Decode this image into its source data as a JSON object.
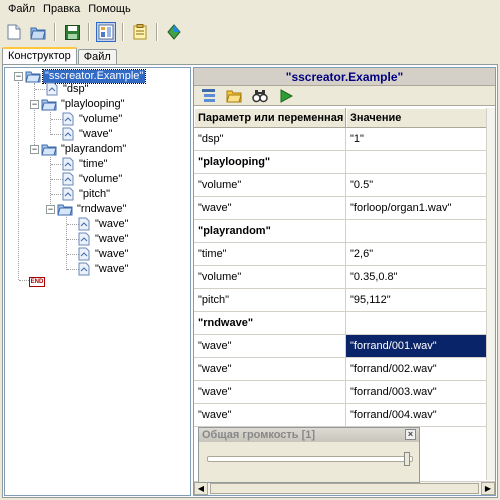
{
  "menu": {
    "file": "Файл",
    "edit": "Правка",
    "help": "Помощь"
  },
  "toolbar": {
    "icons": [
      "new-icon",
      "open-icon",
      "save-icon",
      "designer-icon",
      "notes-icon",
      "export-icon"
    ]
  },
  "tabs": {
    "designer": "Конструктор",
    "file": "Файл"
  },
  "tree": {
    "root": "\"sscreator.Example\"",
    "dsp": "\"dsp\"",
    "playlooping": "\"playlooping\"",
    "pl_volume": "\"volume\"",
    "pl_wave": "\"wave\"",
    "playrandom": "\"playrandom\"",
    "pr_time": "\"time\"",
    "pr_volume": "\"volume\"",
    "pr_pitch": "\"pitch\"",
    "rndwave": "\"rndwave\"",
    "rw_wave1": "\"wave\"",
    "rw_wave2": "\"wave\"",
    "rw_wave3": "\"wave\"",
    "rw_wave4": "\"wave\"",
    "end": "END"
  },
  "properties": {
    "title": "\"sscreator.Example\"",
    "header_param": "Параметр или переменная",
    "header_value": "Значение",
    "rows": [
      {
        "param": "\"dsp\"",
        "value": "\"1\""
      },
      {
        "param": "\"playlooping\"",
        "value": ""
      },
      {
        "param": "\"volume\"",
        "value": "\"0.5\""
      },
      {
        "param": "\"wave\"",
        "value": "\"forloop/organ1.wav\""
      },
      {
        "param": "\"playrandom\"",
        "value": ""
      },
      {
        "param": "\"time\"",
        "value": "\"2,6\""
      },
      {
        "param": "\"volume\"",
        "value": "\"0.35,0.8\""
      },
      {
        "param": "\"pitch\"",
        "value": "\"95,112\""
      },
      {
        "param": "\"rndwave\"",
        "value": ""
      },
      {
        "param": "\"wave\"",
        "value": "\"forrand/001.wav\""
      },
      {
        "param": "\"wave\"",
        "value": "\"forrand/002.wav\""
      },
      {
        "param": "\"wave\"",
        "value": "\"forrand/003.wav\""
      },
      {
        "param": "\"wave\"",
        "value": "\"forrand/004.wav\""
      }
    ]
  },
  "volume_panel": {
    "title": "Общая громкость [1]",
    "close": "×",
    "level": 1.0
  }
}
